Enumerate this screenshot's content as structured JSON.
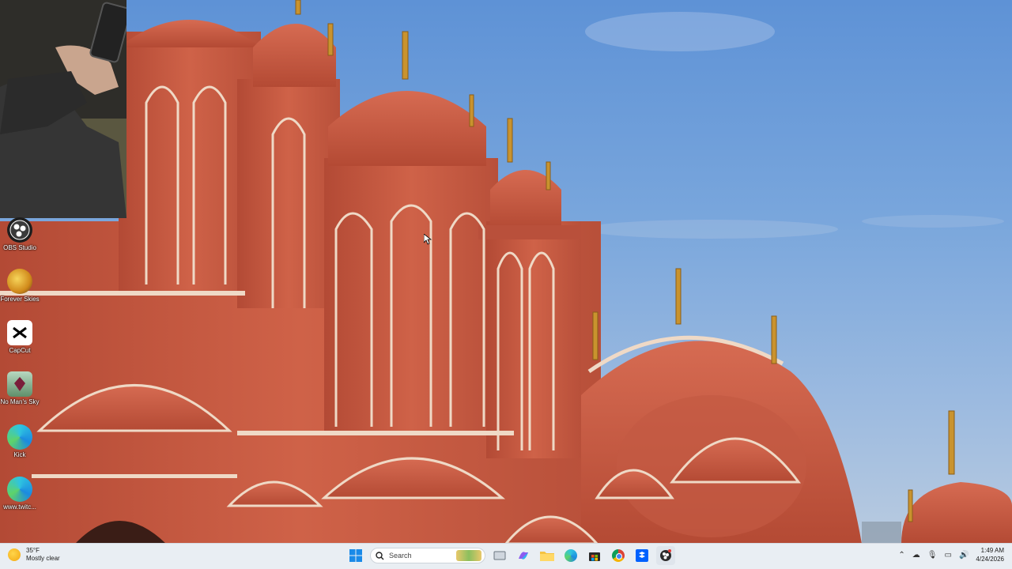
{
  "desktop": {
    "icons": [
      {
        "name": "OBS Studio"
      },
      {
        "name": "Forever Skies"
      },
      {
        "name": "CapCut"
      },
      {
        "name": "No Man's Sky"
      },
      {
        "name": "Kick"
      },
      {
        "name": "www.twitc..."
      }
    ]
  },
  "taskbar": {
    "weather": {
      "temp": "35°F",
      "condition": "Mostly clear",
      "icon": "moon-cloud-icon"
    },
    "search_placeholder": "Search",
    "apps": [
      "start",
      "search",
      "task-view",
      "copilot",
      "file-explorer",
      "edge",
      "store",
      "chrome",
      "dropbox",
      "obs"
    ],
    "clock": {
      "time": "1:49 AM",
      "date": "4/24/2026"
    }
  },
  "colors": {
    "taskbar_bg": "#e9eef3",
    "sky": "#6f9dd6",
    "palace": "#c65a42"
  }
}
